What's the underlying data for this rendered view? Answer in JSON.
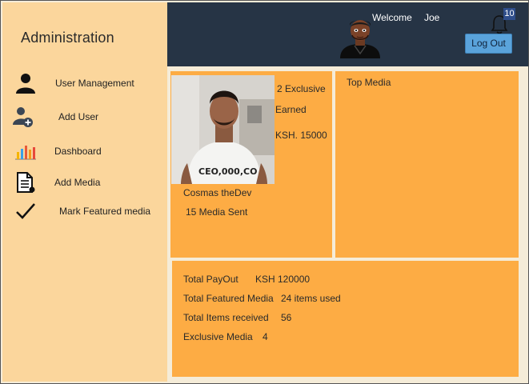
{
  "sidebar": {
    "title": "Administration",
    "items": [
      {
        "label": "User Management",
        "icon": "user-icon"
      },
      {
        "label": "Add User",
        "icon": "add-user-icon"
      },
      {
        "label": "Dashboard",
        "icon": "bar-chart-icon"
      },
      {
        "label": "Add Media",
        "icon": "document-icon"
      },
      {
        "label": "Mark Featured media",
        "icon": "checkmark-icon"
      }
    ]
  },
  "header": {
    "welcome": "Welcome",
    "username": "Joe",
    "notification_count": "10",
    "logout_label": "Log Out"
  },
  "profile_card": {
    "exclusive": "2 Exclusive",
    "earned_label": "Earned",
    "earned_amount": "KSH. 15000",
    "name": "Cosmas theDev",
    "media_sent": "15 Media Sent"
  },
  "top_media": {
    "title": "Top Media"
  },
  "stats": {
    "payout_label": "Total PayOut",
    "payout_value": "KSH 120000",
    "featured_label": "Total Featured Media",
    "featured_value": "24 items used",
    "received_label": "Total Items received",
    "received_value": "56",
    "exclusive_label": "Exclusive Media",
    "exclusive_value": "4"
  },
  "colors": {
    "sidebar": "#fbd69c",
    "header": "#263445",
    "panel": "#fdac44",
    "logout_button": "#5aa3db"
  }
}
